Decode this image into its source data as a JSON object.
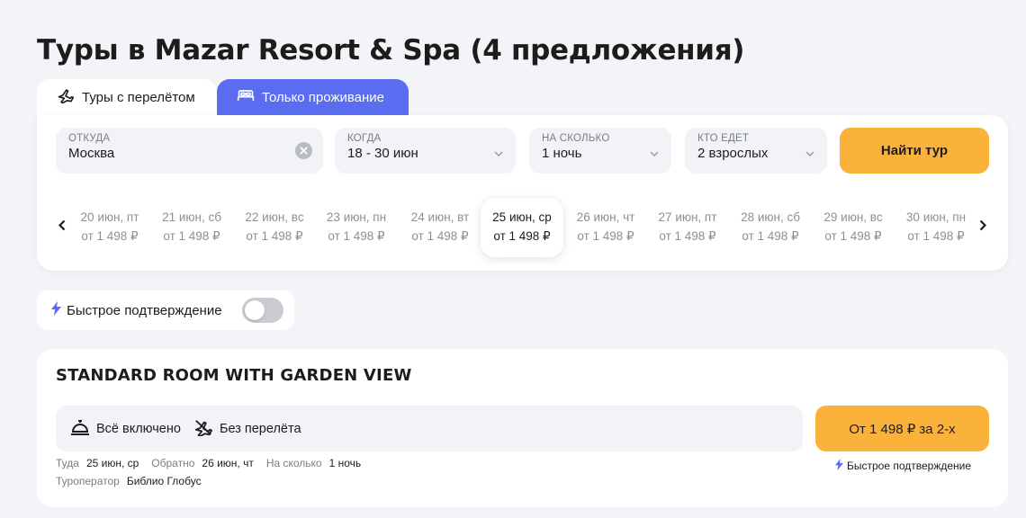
{
  "title": "Туры в Mazar Resort & Spa (4 предложения)",
  "tabs": [
    {
      "label": "Туры с перелётом",
      "icon": "plane-icon"
    },
    {
      "label": "Только проживание",
      "icon": "bed-icon"
    }
  ],
  "search": {
    "from_label": "ОТКУДА",
    "from_value": "Москва",
    "when_label": "КОГДА",
    "when_value": "18 - 30 июн",
    "duration_label": "НА СКОЛЬКО",
    "duration_value": "1 ночь",
    "who_label": "КТО ЕДЕТ",
    "who_value": "2 взрослых",
    "find_label": "Найти тур"
  },
  "dates": [
    {
      "date": "20 июн, пт",
      "price": "от 1 498 ₽"
    },
    {
      "date": "21 июн, сб",
      "price": "от 1 498 ₽"
    },
    {
      "date": "22 июн, вс",
      "price": "от 1 498 ₽"
    },
    {
      "date": "23 июн, пн",
      "price": "от 1 498 ₽"
    },
    {
      "date": "24 июн, вт",
      "price": "от 1 498 ₽"
    },
    {
      "date": "25 июн, ср",
      "price": "от 1 498 ₽",
      "selected": true
    },
    {
      "date": "26 июн, чт",
      "price": "от 1 498 ₽"
    },
    {
      "date": "27 июн, пт",
      "price": "от 1 498 ₽"
    },
    {
      "date": "28 июн, сб",
      "price": "от 1 498 ₽"
    },
    {
      "date": "29 июн, вс",
      "price": "от 1 498 ₽"
    },
    {
      "date": "30 июн, пн",
      "price": "от 1 498 ₽"
    }
  ],
  "quick_confirm": {
    "label": "Быстрое подтверждение",
    "enabled": false
  },
  "offer": {
    "room": "STANDARD ROOM WITH GARDEN VIEW",
    "meal": "Всё включено",
    "flight": "Без перелёта",
    "price": "От 1 498 ₽ за 2-х",
    "there_label": "Туда",
    "there_value": "25 июн, ср",
    "back_label": "Обратно",
    "back_value": "26 июн, чт",
    "duration_label": "На сколько",
    "duration_value": "1 ночь",
    "operator_label": "Туроператор",
    "operator_value": "Библио Глобус",
    "quick_label": "Быстрое подтверждение"
  },
  "colors": {
    "accent": "#5a6cf0",
    "cta": "#fbb23b",
    "background": "#f3f4f8"
  }
}
